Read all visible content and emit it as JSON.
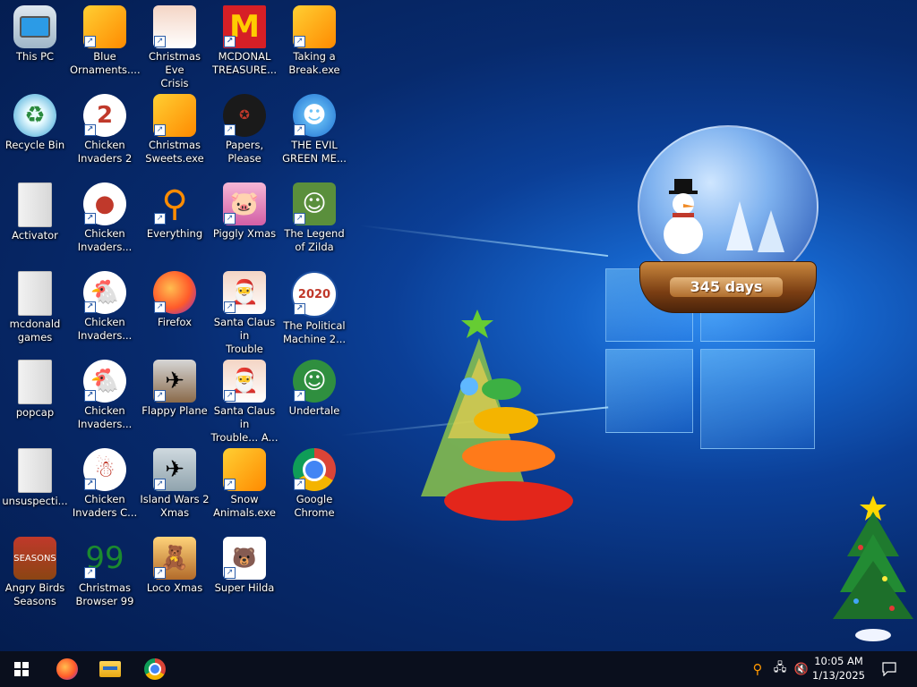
{
  "desktop": {
    "icons": [
      {
        "label": "This PC",
        "glyph": "pc-icon"
      },
      {
        "label": "Blue\nOrnaments....",
        "glyph": "puzzle-icon"
      },
      {
        "label": "Christmas Eve\nCrisis",
        "glyph": "santa-icon"
      },
      {
        "label": "MCDONAL\nTREASURE...",
        "glyph": "mcdonalds-icon",
        "text": "M"
      },
      {
        "label": "Taking a\nBreak.exe",
        "glyph": "puzzle-icon"
      },
      {
        "label": "Recycle Bin",
        "glyph": "recycle-bin-icon",
        "text": "♻"
      },
      {
        "label": "Chicken\nInvaders 2",
        "glyph": "chicken-icon",
        "text": "2"
      },
      {
        "label": "Christmas\nSweets.exe",
        "glyph": "puzzle-icon"
      },
      {
        "label": "Papers, Please",
        "glyph": "papers-please-icon",
        "text": "✪"
      },
      {
        "label": "THE EVIL\nGREEN ME...",
        "glyph": "msn-icon",
        "text": "☻"
      },
      {
        "label": "Activator",
        "glyph": "folder-icon"
      },
      {
        "label": "Chicken\nInvaders...",
        "glyph": "chicken-icon",
        "text": "●"
      },
      {
        "label": "Everything",
        "glyph": "search-ring-icon",
        "text": "⚲"
      },
      {
        "label": "Piggly Xmas",
        "glyph": "pig-icon",
        "text": "🐷"
      },
      {
        "label": "The Legend\nof Zilda",
        "glyph": "zelda-icon",
        "text": "☺"
      },
      {
        "label": "mcdonald\ngames",
        "glyph": "folder-icon"
      },
      {
        "label": "Chicken\nInvaders...",
        "glyph": "chicken-icon",
        "text": "🐔"
      },
      {
        "label": "Firefox",
        "glyph": "firefox-icon"
      },
      {
        "label": "Santa Claus in\nTrouble",
        "glyph": "santa-icon",
        "text": "🎅"
      },
      {
        "label": "The Political\nMachine 2...",
        "glyph": "political-machine-icon",
        "text": "2020"
      },
      {
        "label": "popcap",
        "glyph": "folder-icon"
      },
      {
        "label": "Chicken\nInvaders...",
        "glyph": "chicken-icon",
        "text": "🐔"
      },
      {
        "label": "Flappy Plane",
        "glyph": "flappy-plane-icon",
        "text": "✈"
      },
      {
        "label": "Santa Claus in\nTrouble... A...",
        "glyph": "santa-icon",
        "text": "🎅"
      },
      {
        "label": "Undertale",
        "glyph": "undertale-icon",
        "text": "☺"
      },
      {
        "label": "unsuspecti...",
        "glyph": "folder-icon"
      },
      {
        "label": "Chicken\nInvaders C...",
        "glyph": "chicken-icon",
        "text": "☃"
      },
      {
        "label": "Island Wars 2\nXmas",
        "glyph": "island-wars-icon",
        "text": "✈"
      },
      {
        "label": "Snow\nAnimals.exe",
        "glyph": "puzzle-icon"
      },
      {
        "label": "Google\nChrome",
        "glyph": "chrome-icon"
      },
      {
        "label": "Angry Birds\nSeasons",
        "glyph": "angry-birds-icon",
        "text": "SEASONS"
      },
      {
        "label": "Christmas\nBrowser 99",
        "glyph": "xmas-tree-icon",
        "text": "99"
      },
      {
        "label": "Loco Xmas",
        "glyph": "bear-icon",
        "text": "🧸"
      },
      {
        "label": "Super Hilda",
        "glyph": "hilda-icon",
        "text": "🐻"
      }
    ]
  },
  "widgets": {
    "snow_globe_counter": "345 days"
  },
  "taskbar": {
    "start_label": "Start",
    "pinned": [
      {
        "name": "firefox-taskbar-button"
      },
      {
        "name": "file-explorer-taskbar-button"
      },
      {
        "name": "chrome-taskbar-button"
      }
    ],
    "clock": {
      "time": "10:05 AM",
      "date": "1/13/2025"
    }
  },
  "colors": {
    "taskbar_bg": "#0a0f1d",
    "desktop_accent": "#1563c9"
  }
}
